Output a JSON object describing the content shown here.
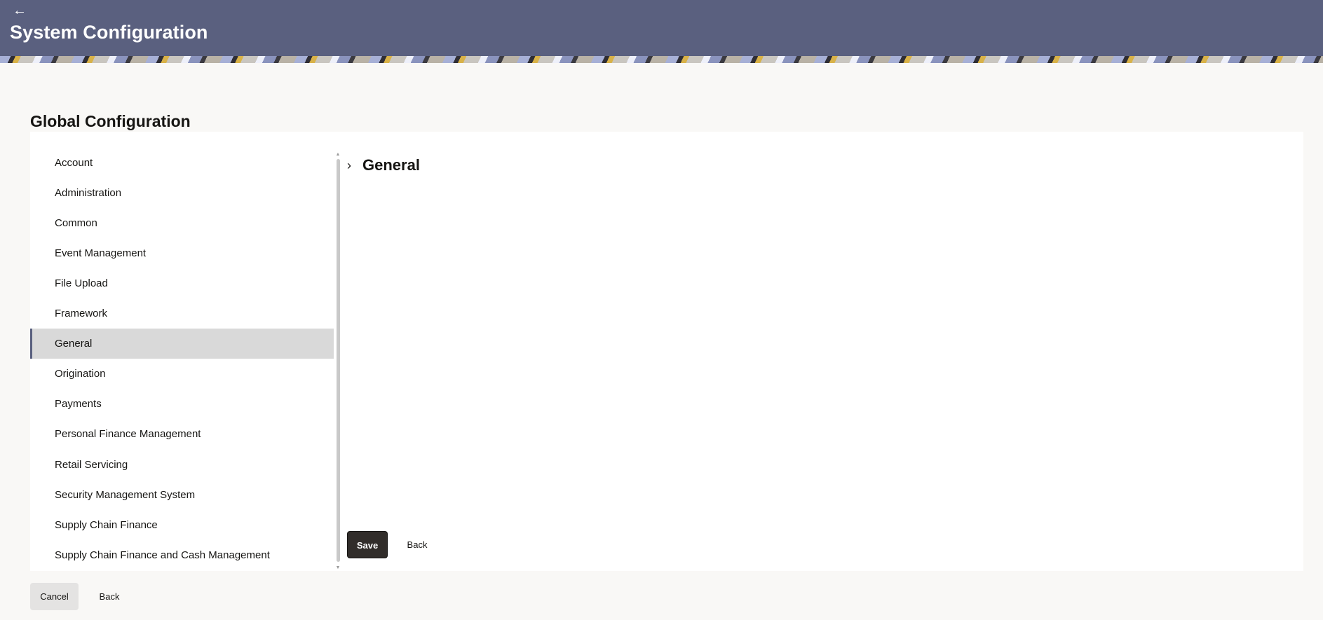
{
  "header": {
    "back_icon": "back-arrow-icon",
    "title": "System Configuration",
    "color": "#5a607f"
  },
  "page": {
    "title": "Global Configuration"
  },
  "nav": {
    "items": [
      {
        "label": "Account"
      },
      {
        "label": "Administration"
      },
      {
        "label": "Common"
      },
      {
        "label": "Event Management"
      },
      {
        "label": "File Upload"
      },
      {
        "label": "Framework"
      },
      {
        "label": "General",
        "active": true
      },
      {
        "label": "Origination"
      },
      {
        "label": "Payments"
      },
      {
        "label": "Personal Finance Management"
      },
      {
        "label": "Retail Servicing"
      },
      {
        "label": "Security Management System"
      },
      {
        "label": "Supply Chain Finance"
      },
      {
        "label": "Supply Chain Finance and Cash Management"
      }
    ]
  },
  "section": {
    "icon": "chevron-right-icon",
    "title": "General"
  },
  "actions": {
    "save_label": "Save",
    "back_label": "Back"
  },
  "footer": {
    "cancel_label": "Cancel",
    "back_label": "Back"
  }
}
